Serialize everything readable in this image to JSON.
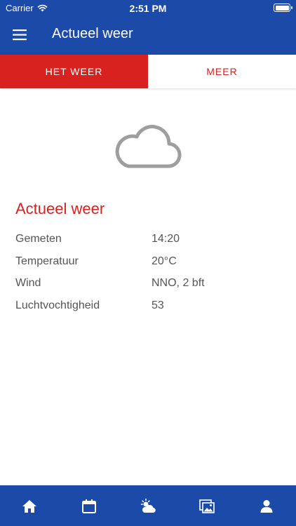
{
  "status_bar": {
    "carrier": "Carrier",
    "time": "2:51 PM"
  },
  "header": {
    "title": "Actueel weer",
    "menu_icon": "hamburger-menu-icon"
  },
  "tabs": [
    {
      "label": "HET WEER",
      "active": true
    },
    {
      "label": "MEER",
      "active": false
    }
  ],
  "weather": {
    "icon": "cloud-icon"
  },
  "section": {
    "title": "Actueel weer",
    "rows": [
      {
        "label": "Gemeten",
        "value": "14:20"
      },
      {
        "label": "Temperatuur",
        "value": "20°C"
      },
      {
        "label": "Wind",
        "value": "NNO, 2 bft"
      },
      {
        "label": "Luchtvochtigheid",
        "value": "53"
      }
    ]
  },
  "bottom_nav": [
    {
      "icon": "home-icon"
    },
    {
      "icon": "calendar-icon"
    },
    {
      "icon": "weather-icon"
    },
    {
      "icon": "photos-icon"
    },
    {
      "icon": "profile-icon"
    }
  ],
  "colors": {
    "primary": "#1b4aa8",
    "accent": "#d7221f",
    "text": "#555555",
    "icon_gray": "#9e9e9e"
  }
}
